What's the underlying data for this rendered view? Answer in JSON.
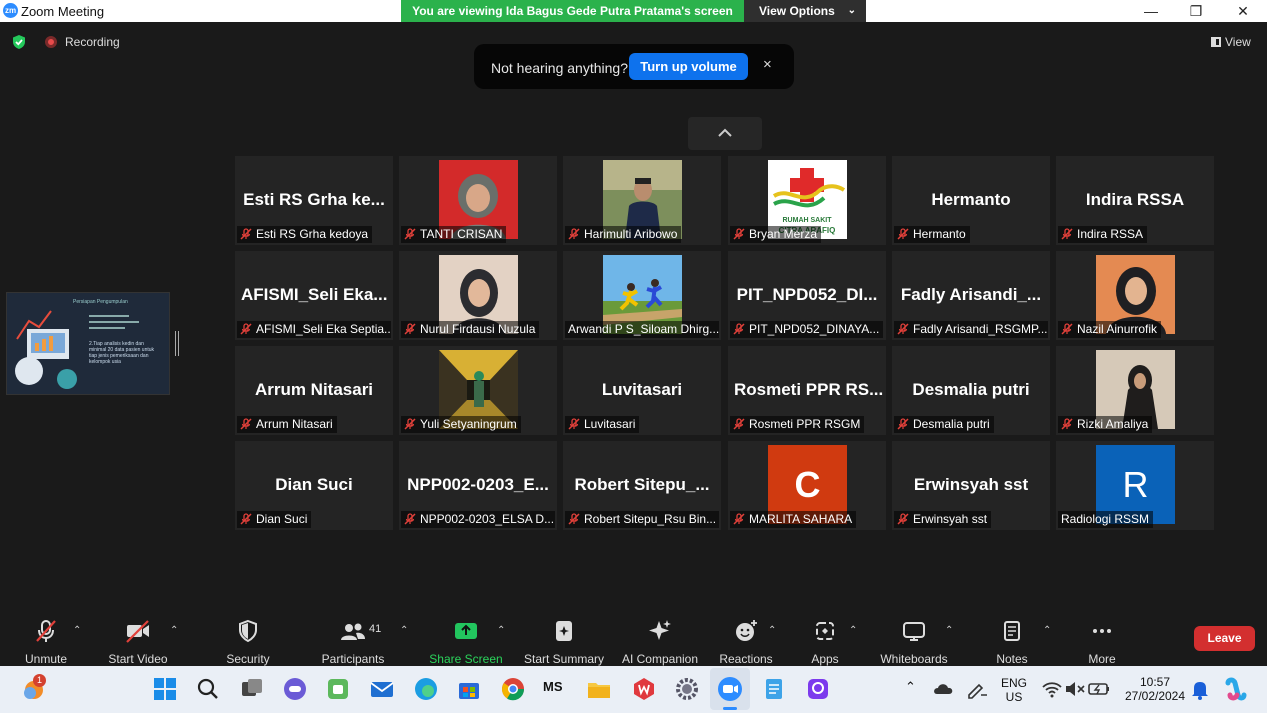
{
  "titlebar": {
    "logo": "zm",
    "title": "Zoom Meeting",
    "minimize": "—",
    "maximize": "❐",
    "close": "✕"
  },
  "share_banner": {
    "text": "You are viewing Ida Bagus Gede Putra Pratama's screen",
    "view_options": "View Options"
  },
  "status": {
    "recording": "Recording",
    "view": "View"
  },
  "toast": {
    "message": "Not hearing anything?",
    "button": "Turn up volume",
    "close": "×"
  },
  "tiles": [
    {
      "big": "Esti RS Grha ke...",
      "name": "Esti RS Grha kedoya",
      "photo": ""
    },
    {
      "big": "",
      "name": "TANTI CRISAN",
      "photo": "red"
    },
    {
      "big": "",
      "name": "Harimulti Aribowo",
      "photo": "outdoor"
    },
    {
      "big": "",
      "name": "Bryan Merza",
      "photo": "hospital-logo"
    },
    {
      "big": "Hermanto",
      "name": "Hermanto",
      "photo": ""
    },
    {
      "big": "Indira RSSA",
      "name": "Indira RSSA",
      "photo": ""
    },
    {
      "big": "AFISMI_Seli Eka...",
      "name": "AFISMI_Seli Eka Septia...",
      "photo": ""
    },
    {
      "big": "",
      "name": "Nurul Firdausi Nuzula",
      "photo": "beige"
    },
    {
      "big": "",
      "name": "Arwandi P S_Siloam Dhirg...",
      "photo": "runners",
      "no_mute": true
    },
    {
      "big": "PIT_NPD052_DI...",
      "name": "PIT_NPD052_DINAYA...",
      "photo": ""
    },
    {
      "big": "Fadly Arisandi_...",
      "name": "Fadly Arisandi_RSGMP...",
      "photo": ""
    },
    {
      "big": "",
      "name": "Nazil Ainurrofik",
      "photo": "orange"
    },
    {
      "big": "Arrum Nitasari",
      "name": "Arrum Nitasari",
      "photo": ""
    },
    {
      "big": "",
      "name": "Yuli Setyaningrum",
      "photo": "corridor"
    },
    {
      "big": "Luvitasari",
      "name": "Luvitasari",
      "photo": ""
    },
    {
      "big": "Rosmeti PPR RS...",
      "name": "Rosmeti PPR RSGM",
      "photo": ""
    },
    {
      "big": "Desmalia putri",
      "name": "Desmalia putri",
      "photo": ""
    },
    {
      "big": "",
      "name": "Rizki Amaliya",
      "photo": "wall"
    },
    {
      "big": "Dian Suci",
      "name": "Dian Suci",
      "photo": ""
    },
    {
      "big": "NPP002-0203_E...",
      "name": "NPP002-0203_ELSA D...",
      "photo": ""
    },
    {
      "big": "Robert Sitepu_...",
      "name": "Robert Sitepu_Rsu Bin...",
      "photo": ""
    },
    {
      "big": "",
      "name": "MARLITA SAHARA",
      "photo": "letter-c",
      "letter": "C"
    },
    {
      "big": "Erwinsyah sst",
      "name": "Erwinsyah sst",
      "photo": ""
    },
    {
      "big": "",
      "name": "Radiologi RSSM",
      "photo": "letter-r",
      "letter": "R",
      "no_mute": true
    }
  ],
  "shared_screen": {
    "lines": "2.Tiap analisis kedin dan minimal 20 data pasien untuk tiap jenis pemeriksaan dan kelompok usia"
  },
  "toolbar": {
    "unmute": "Unmute",
    "start_video": "Start Video",
    "security": "Security",
    "participants": "Participants",
    "participant_count": "41",
    "share_screen": "Share Screen",
    "start_summary": "Start Summary",
    "ai_companion": "AI Companion",
    "reactions": "Reactions",
    "apps": "Apps",
    "whiteboards": "Whiteboards",
    "notes": "Notes",
    "more": "More",
    "leave": "Leave"
  },
  "taskbar": {
    "notification_badge": "1",
    "lang": "ENG",
    "region": "US",
    "time": "10:57",
    "date": "27/02/2024",
    "ms_label": "MS"
  },
  "colors": {
    "banner_green": "#2bb24c",
    "toast_button_blue": "#0e72ed",
    "leave_red": "#d32f2f",
    "share_icon_green": "#22c55e",
    "muted_red": "#e0403a"
  }
}
